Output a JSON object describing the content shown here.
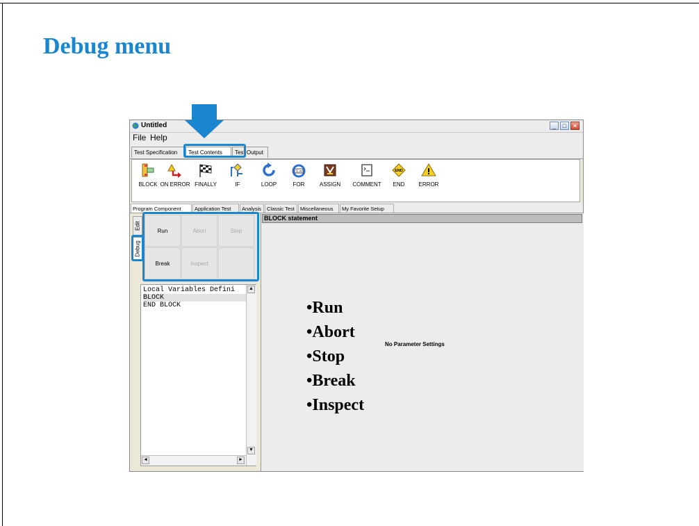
{
  "slide": {
    "title": "Debug menu"
  },
  "window": {
    "title": "Untitled",
    "menu": [
      "File",
      "Help"
    ],
    "tabs": [
      {
        "label": "Test Specification",
        "active": false
      },
      {
        "label": "Test Contents",
        "active": true
      },
      {
        "label": "Test Output",
        "active": false
      }
    ],
    "toolbar": [
      {
        "label": "BLOCK",
        "icon": "block-icon"
      },
      {
        "label": "ON ERROR",
        "icon": "on-error-icon"
      },
      {
        "label": "FINALLY",
        "icon": "finally-flag-icon"
      },
      {
        "label": "IF",
        "icon": "if-branch-icon"
      },
      {
        "label": "LOOP",
        "icon": "loop-icon"
      },
      {
        "label": "FOR",
        "icon": "for-icon"
      },
      {
        "label": "ASSIGN",
        "icon": "assign-icon"
      },
      {
        "label": "COMMENT",
        "icon": "comment-icon"
      },
      {
        "label": "END",
        "icon": "end-icon"
      },
      {
        "label": "ERROR",
        "icon": "error-warning-icon"
      }
    ],
    "subtabs": [
      {
        "label": "Program Component",
        "active": true
      },
      {
        "label": "Application Test",
        "active": false
      },
      {
        "label": "Analysis",
        "active": false
      },
      {
        "label": "Classic Test",
        "active": false
      },
      {
        "label": "Miscellaneous",
        "active": false
      },
      {
        "label": "My Favorite Setup",
        "active": false
      }
    ],
    "side_tabs": {
      "edit": "Edit",
      "debug": "Debug"
    },
    "debug_buttons": [
      {
        "label": "Run",
        "enabled": true
      },
      {
        "label": "Abort",
        "enabled": false
      },
      {
        "label": "Step",
        "enabled": false
      },
      {
        "label": "Break",
        "enabled": true
      },
      {
        "label": "Inspect",
        "enabled": false
      },
      {
        "label": "",
        "enabled": false
      }
    ],
    "code_lines": [
      "Local Variables Defini",
      "BLOCK",
      "END BLOCK"
    ],
    "statement_header": "BLOCK statement",
    "no_params_text": "No Parameter Settings"
  },
  "bullets": [
    "•Run",
    "•Abort",
    "•Stop",
    "•Break",
    "•Inspect"
  ],
  "colors": {
    "accent": "#1a86cf"
  }
}
